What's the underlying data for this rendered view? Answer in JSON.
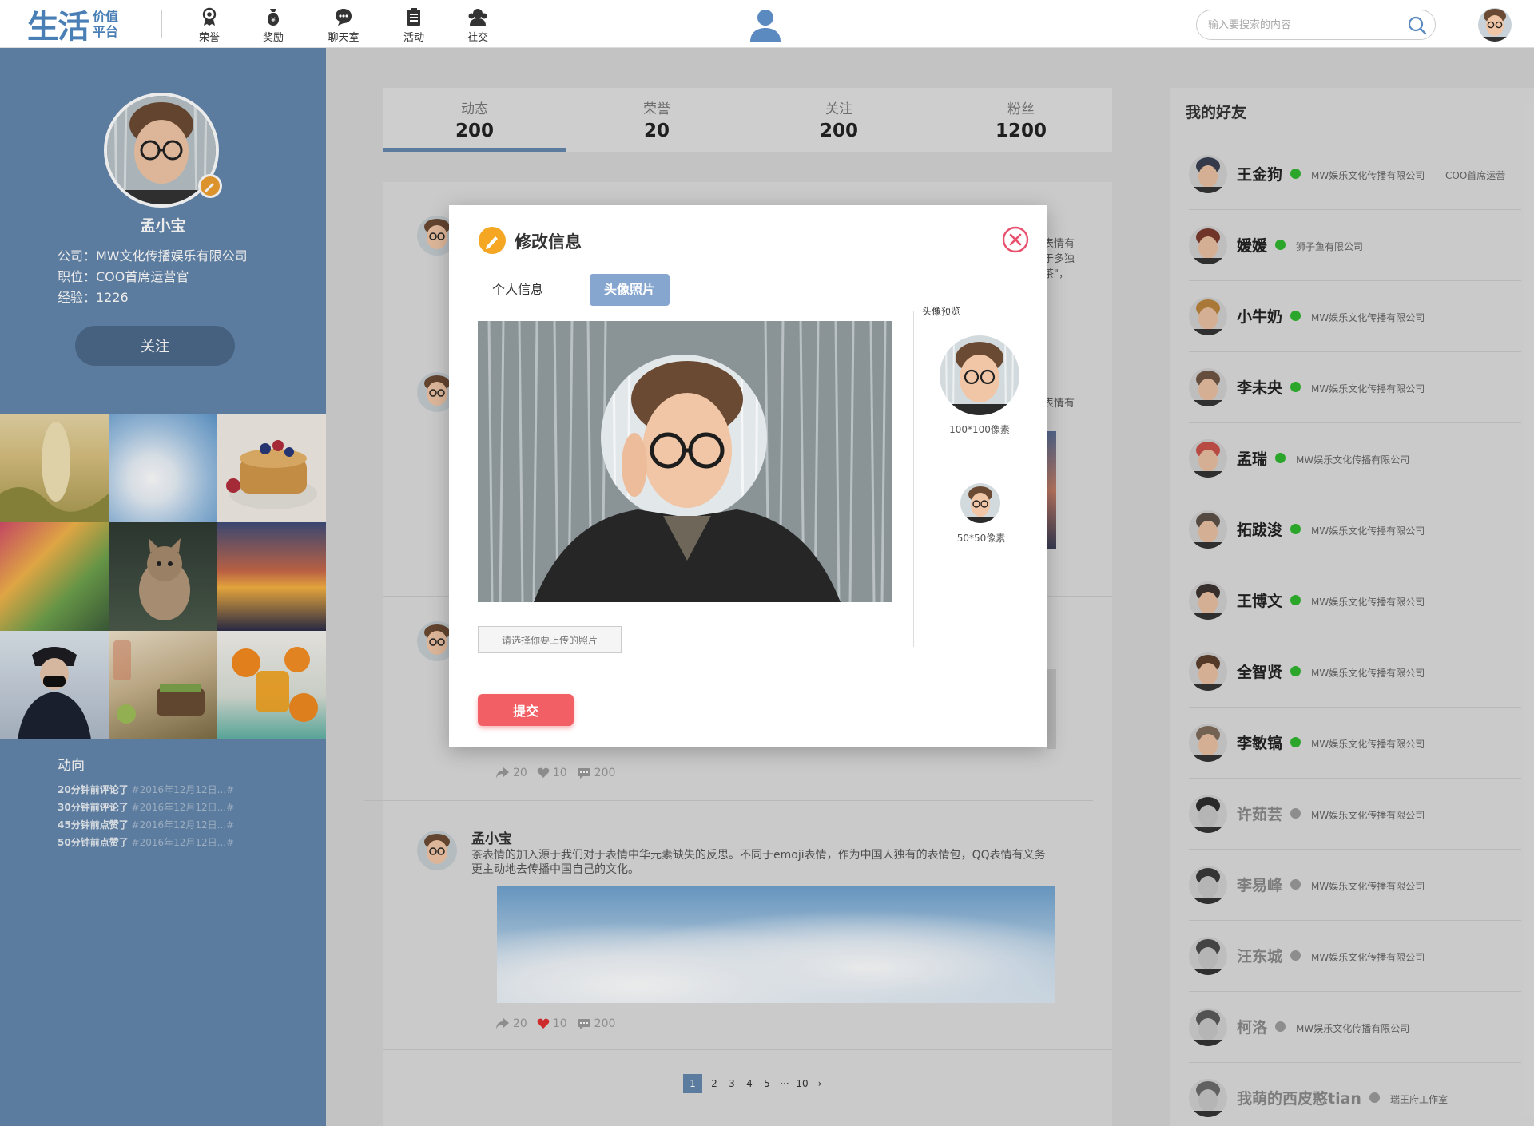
{
  "brand": {
    "logo_main": "生活",
    "logo_top": "价值",
    "logo_bottom": "平台",
    "color": "#4a7fb5"
  },
  "nav": [
    {
      "label": "荣誉",
      "icon": "medal-icon"
    },
    {
      "label": "奖励",
      "icon": "money-bag-icon"
    },
    {
      "label": "聊天室",
      "icon": "chat-bubble-icon"
    },
    {
      "label": "活动",
      "icon": "clipboard-icon"
    },
    {
      "label": "社交",
      "icon": "group-icon"
    }
  ],
  "search": {
    "placeholder": "输入要搜索的内容"
  },
  "profile": {
    "name": "孟小宝",
    "company": "公司：MW文化传播娱乐有限公司",
    "position": "职位：COO首席运营官",
    "experience": "经验：1226",
    "follow_label": "关注",
    "trend_title": "动向",
    "trends": [
      {
        "when": "20分钟前评论了",
        "what": "#2016年12月12日...#"
      },
      {
        "when": "30分钟前评论了",
        "what": "#2016年12月12日...#"
      },
      {
        "when": "45分钟前点赞了",
        "what": "#2016年12月12日...#"
      },
      {
        "when": "50分钟前点赞了",
        "what": "#2016年12月12日...#"
      }
    ]
  },
  "stats": [
    {
      "label": "动态",
      "value": "200",
      "active": true
    },
    {
      "label": "荣誉",
      "value": "20"
    },
    {
      "label": "关注",
      "value": "200"
    },
    {
      "label": "粉丝",
      "value": "1200"
    }
  ],
  "feed": {
    "fragment1": "表情有\n于多独\n茶\"，",
    "fragment2": "表情有",
    "post1_meta": {
      "share": "20",
      "like": "10",
      "comment": "200"
    },
    "post2": {
      "name": "孟小宝",
      "text": "茶表情的加入源于我们对于表情中华元素缺失的反思。不同于emoji表情，作为中国人独有的表情包，QQ表情有义务更主动地去传播中国自己的文化。",
      "share": "20",
      "like": "10",
      "comment": "200",
      "liked": true
    }
  },
  "pagination": {
    "pages": [
      "1",
      "2",
      "3",
      "4",
      "5",
      "10"
    ],
    "ellipsis": "···",
    "current": "1",
    "next": "›"
  },
  "friends": {
    "title": "我的好友",
    "list": [
      {
        "name": "王金狗",
        "online": true,
        "company": "MW娱乐文化传播有限公司",
        "position": "COO首席运营"
      },
      {
        "name": "媛媛",
        "online": true,
        "company": "狮子鱼有限公司"
      },
      {
        "name": "小牛奶",
        "online": true,
        "company": "MW娱乐文化传播有限公司"
      },
      {
        "name": "李未央",
        "online": true,
        "company": "MW娱乐文化传播有限公司"
      },
      {
        "name": "孟瑞",
        "online": true,
        "company": "MW娱乐文化传播有限公司"
      },
      {
        "name": "拓跋浚",
        "online": true,
        "company": "MW娱乐文化传播有限公司"
      },
      {
        "name": "王博文",
        "online": true,
        "company": "MW娱乐文化传播有限公司"
      },
      {
        "name": "全智贤",
        "online": true,
        "company": "MW娱乐文化传播有限公司"
      },
      {
        "name": "李敏镐",
        "online": true,
        "company": "MW娱乐文化传播有限公司"
      },
      {
        "name": "许茹芸",
        "online": false,
        "company": "MW娱乐文化传播有限公司"
      },
      {
        "name": "李易峰",
        "online": false,
        "company": "MW娱乐文化传播有限公司"
      },
      {
        "name": "汪东城",
        "online": false,
        "company": "MW娱乐文化传播有限公司"
      },
      {
        "name": "柯洛",
        "online": false,
        "company": "MW娱乐文化传播有限公司"
      },
      {
        "name": "我萌的西皮憨tian",
        "online": false,
        "company": "瑞王府工作室"
      }
    ]
  },
  "modal": {
    "title": "修改信息",
    "tab_info": "个人信息",
    "tab_photo": "头像照片",
    "active_tab": "头像照片",
    "preview_title": "头像预览",
    "preview_large_label": "100*100像素",
    "preview_small_label": "50*50像素",
    "upload_label": "请选择你要上传的照片",
    "submit_label": "提交"
  },
  "colors": {
    "sidebar": "#6487ad",
    "accent": "#86a6cf",
    "submit": "#f26065",
    "online": "#2fb52f",
    "offline": "#999999",
    "close": "#e8506e",
    "like_red": "#e03030"
  }
}
